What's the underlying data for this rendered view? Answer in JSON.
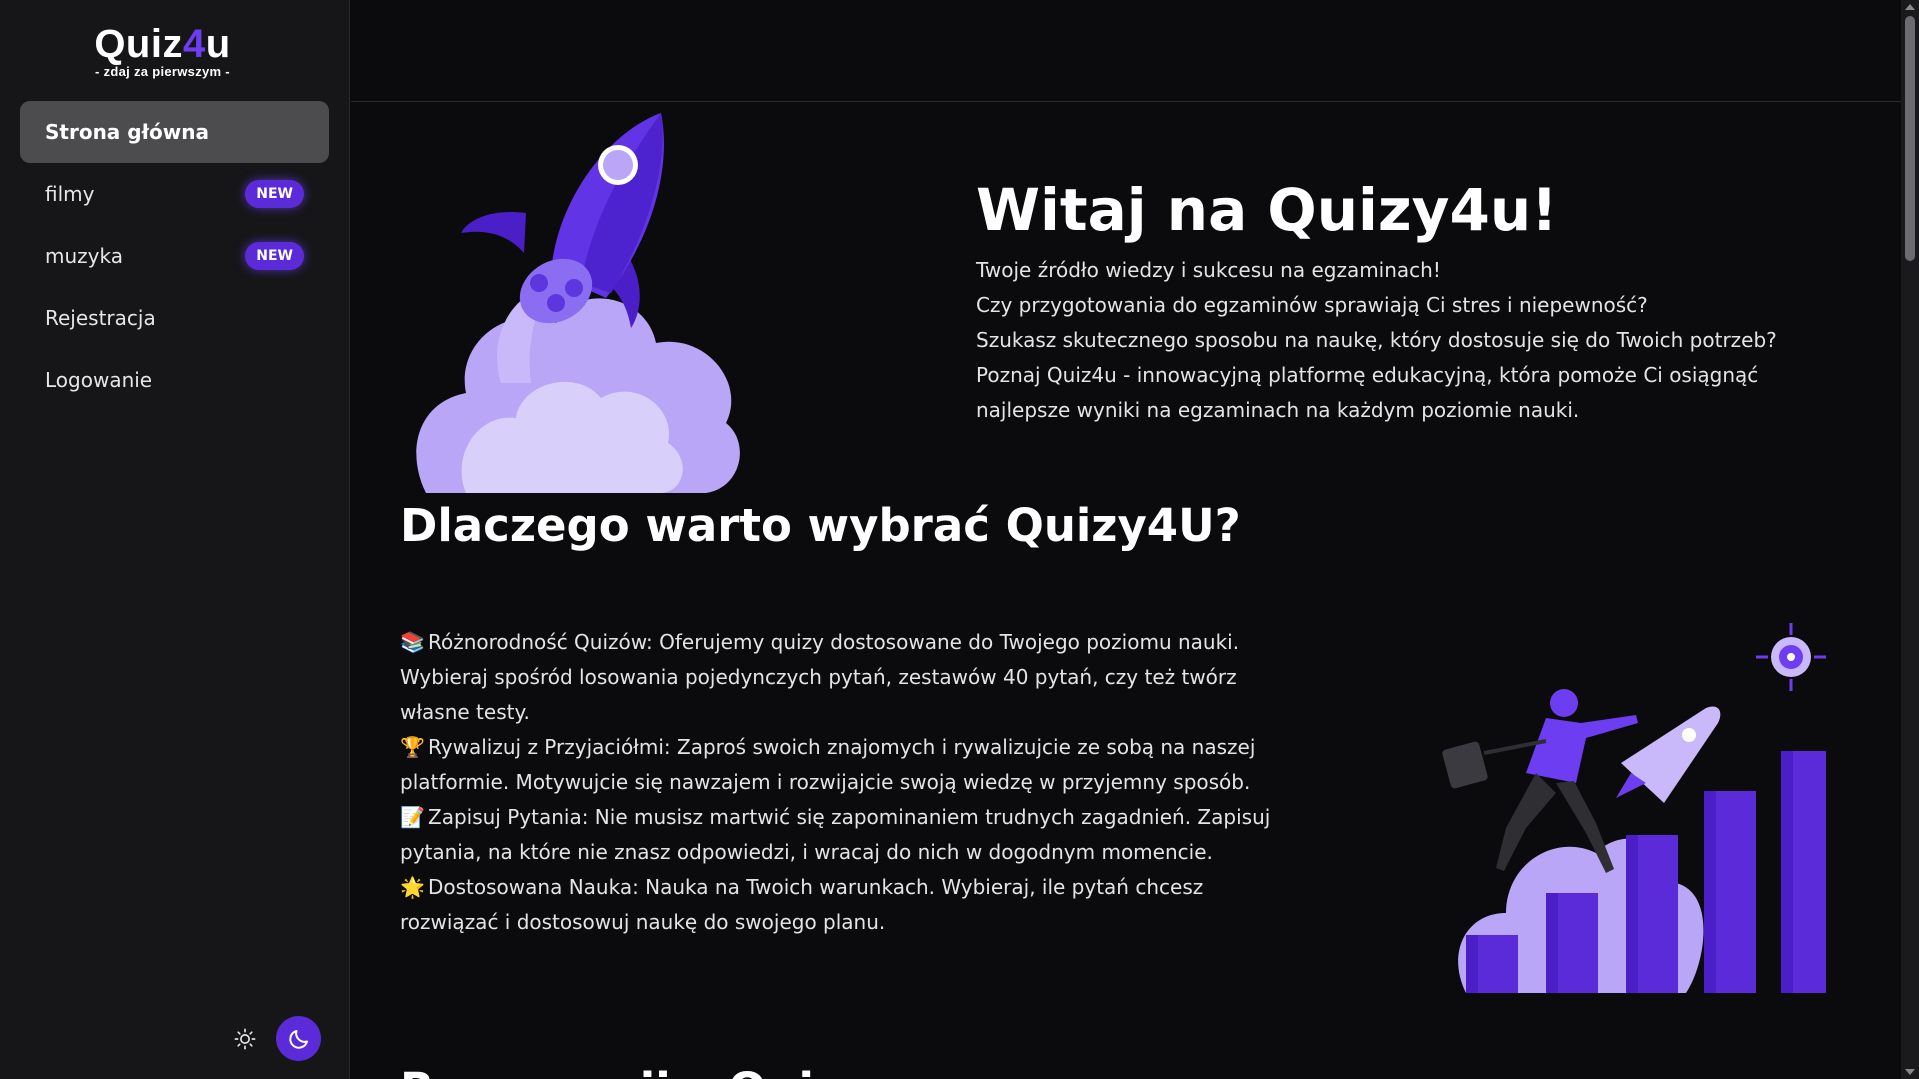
{
  "brand": {
    "name_part1": "Quiz",
    "name_accent": "4",
    "name_part2": "u",
    "tagline": "- zdaj za pierwszym -"
  },
  "sidebar": {
    "items": [
      {
        "label": "Strona główna",
        "active": true
      },
      {
        "label": "filmy",
        "badge": "NEW"
      },
      {
        "label": "muzyka",
        "badge": "NEW"
      },
      {
        "label": "Rejestracja"
      },
      {
        "label": "Logowanie"
      }
    ]
  },
  "theme": {
    "light_icon": "sun-icon",
    "dark_icon": "moon-icon",
    "active": "dark"
  },
  "hero": {
    "title": "Witaj na Quizy4u!",
    "lines": [
      "Twoje źródło wiedzy i sukcesu na egzaminach!",
      "Czy przygotowania do egzaminów sprawiają Ci stres i niepewność?",
      "Szukasz skutecznego sposobu na naukę, który dostosuje się do Twoich potrzeb?",
      "Poznaj Quiz4u - innowacyjną platformę edukacyjną, która pomoże Ci osiągnąć najlepsze wyniki na egzaminach na każdym poziomie nauki."
    ]
  },
  "why": {
    "title": "Dlaczego warto wybrać Quizy4U?",
    "features": [
      {
        "emoji": "📚",
        "text": "Różnorodność Quizów: Oferujemy quizy dostosowane do Twojego poziomu nauki. Wybieraj spośród losowania pojedynczych pytań, zestawów 40 pytań, czy też twórz własne testy."
      },
      {
        "emoji": "🏆",
        "text": "Rywalizuj z Przyjaciółmi: Zaproś swoich znajomych i rywalizujcie ze sobą na naszej platformie. Motywujcie się nawzajem i rozwijajcie swoją wiedzę w przyjemny sposób."
      },
      {
        "emoji": "📝",
        "text": "Zapisuj Pytania: Nie musisz martwić się zapominaniem trudnych zagadnień. Zapisuj pytania, na które nie znasz odpowiedzi, i wracaj do nich w dogodnym momencie."
      },
      {
        "emoji": "🌟",
        "text": "Dostosowana Nauka: Nauka na Twoich warunkach. Wybieraj, ile pytań chcesz rozwiązać i dostosowuj naukę do swojego planu."
      }
    ]
  },
  "next_section": {
    "title": "Rozpocznij z Quizy"
  },
  "colors": {
    "accent": "#6d3df2",
    "badge": "#5b2bd9",
    "sidebar_bg": "#161618",
    "page_bg": "#0b0b0d",
    "active_item_bg": "#4c4c4f"
  }
}
